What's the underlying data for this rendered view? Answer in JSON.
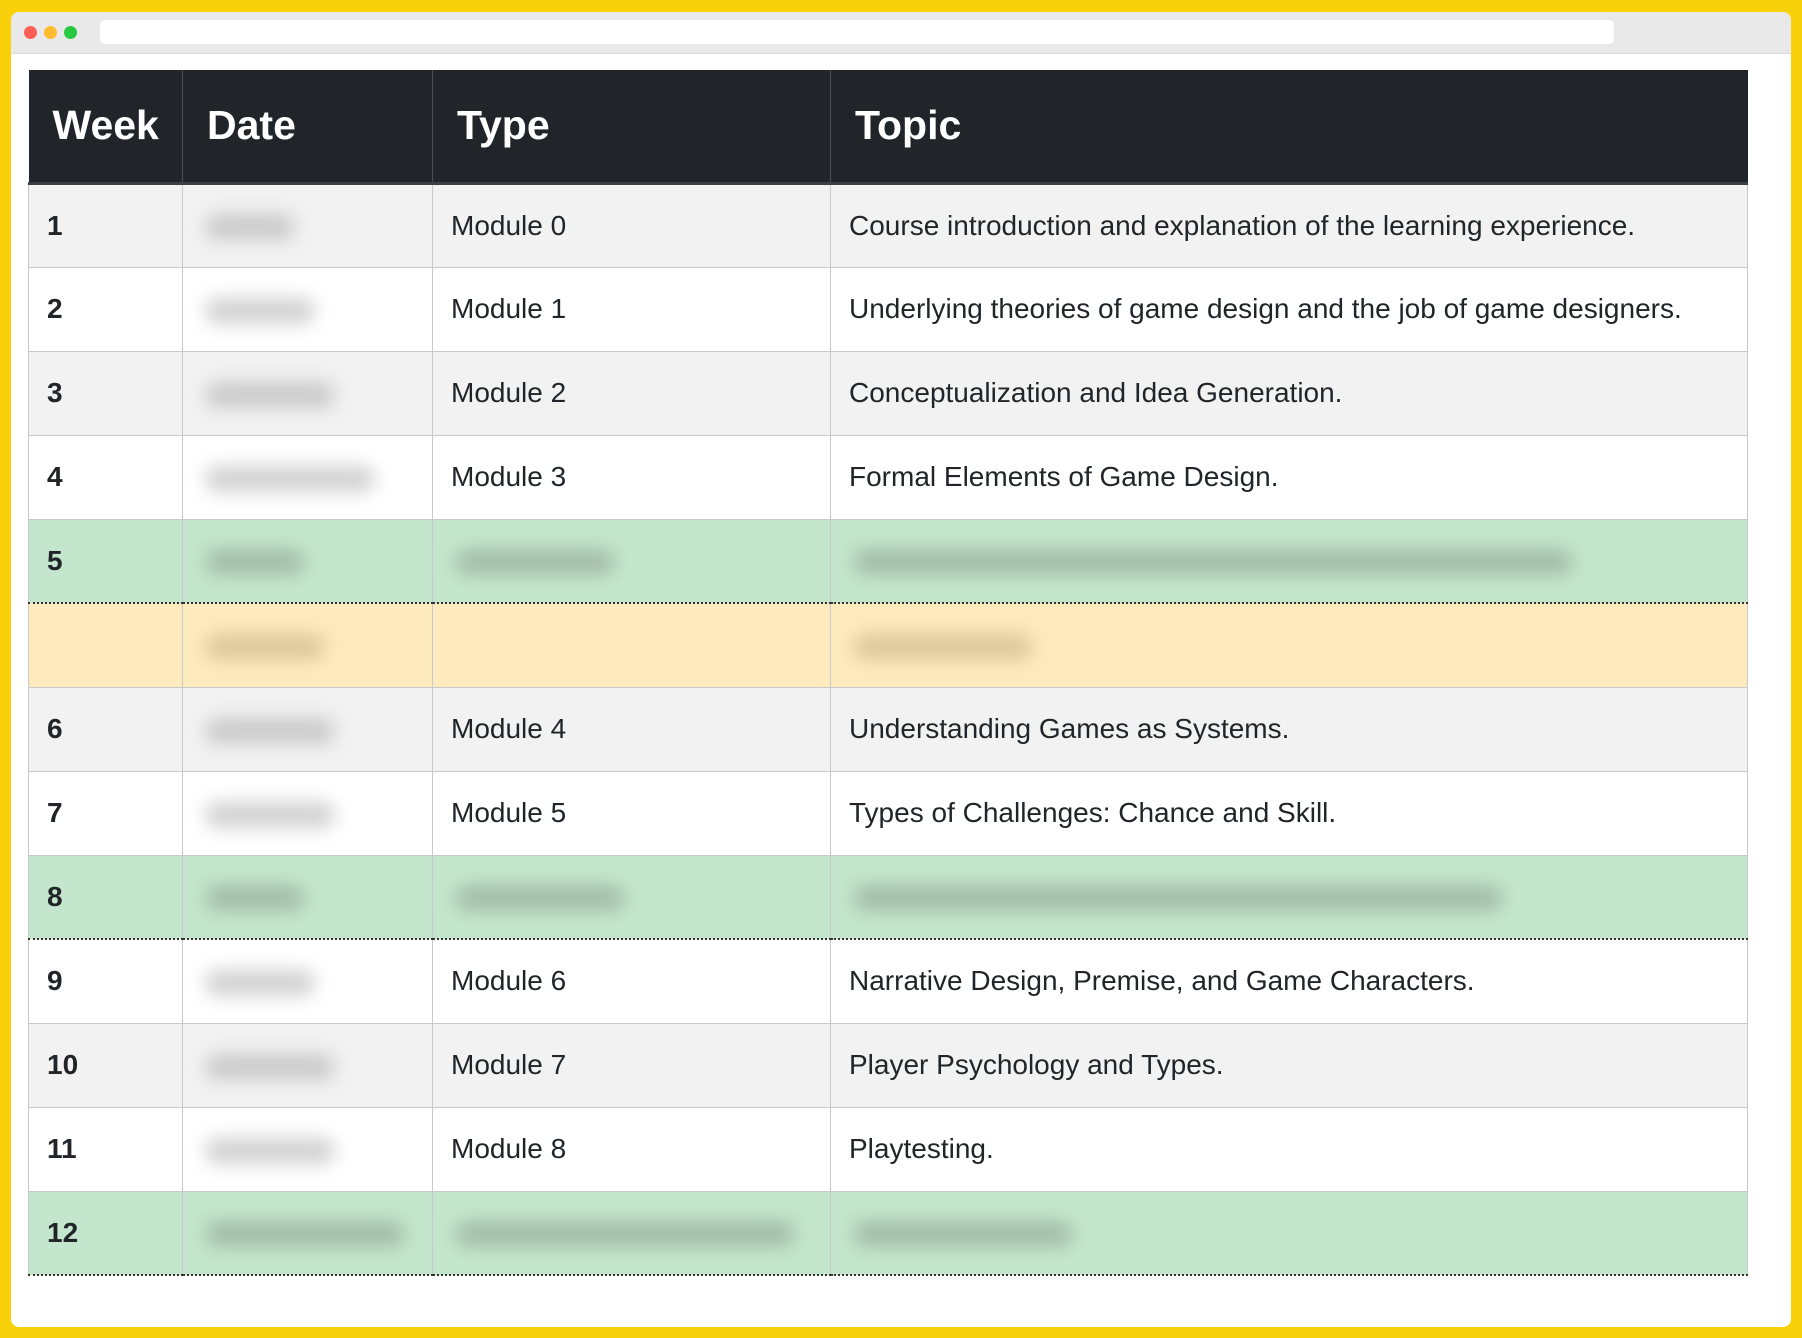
{
  "table": {
    "headers": [
      "Week",
      "Date",
      "Type",
      "Topic"
    ],
    "rows": [
      {
        "week": "1",
        "type": "Module 0",
        "topic": "Course introduction and explanation of the learning experience.",
        "variant": "odd"
      },
      {
        "week": "2",
        "type": "Module 1",
        "topic": "Underlying theories of game design and the job of game designers.",
        "variant": "even"
      },
      {
        "week": "3",
        "type": "Module 2",
        "topic": "Conceptualization and Idea Generation.",
        "variant": "odd"
      },
      {
        "week": "4",
        "type": "Module 3",
        "topic": "Formal Elements of Game Design.",
        "variant": "even"
      },
      {
        "week": "5",
        "type": "",
        "topic": "",
        "variant": "hl"
      },
      {
        "week": "",
        "type": "",
        "topic": "",
        "variant": "yl"
      },
      {
        "week": "6",
        "type": "Module 4",
        "topic": "Understanding Games as Systems.",
        "variant": "odd"
      },
      {
        "week": "7",
        "type": "Module 5",
        "topic": "Types of Challenges: Chance and Skill.",
        "variant": "even"
      },
      {
        "week": "8",
        "type": "",
        "topic": "",
        "variant": "hl"
      },
      {
        "week": "9",
        "type": "Module 6",
        "topic": "Narrative Design, Premise, and Game Characters.",
        "variant": "even"
      },
      {
        "week": "10",
        "type": "Module 7",
        "topic": "Player Psychology and Types.",
        "variant": "odd"
      },
      {
        "week": "11",
        "type": "Module 8",
        "topic": "Playtesting.",
        "variant": "even"
      },
      {
        "week": "12",
        "type": "",
        "topic": "",
        "variant": "hl"
      }
    ]
  }
}
